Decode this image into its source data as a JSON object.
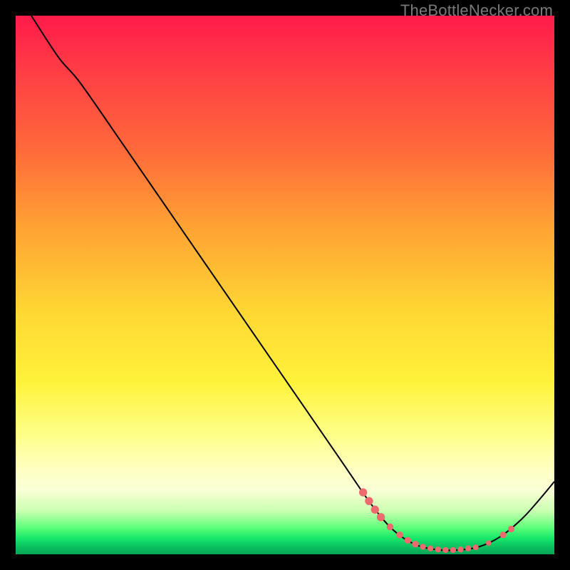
{
  "watermark": "TheBottleNecker.com",
  "chart_data": {
    "type": "line",
    "title": "",
    "xlabel": "",
    "ylabel": "",
    "xlim": [
      0,
      100
    ],
    "ylim": [
      0,
      100
    ],
    "grid": false,
    "curve": [
      {
        "x": 2.9,
        "y": 100.0
      },
      {
        "x": 8.0,
        "y": 92.2
      },
      {
        "x": 12.0,
        "y": 87.5
      },
      {
        "x": 20.0,
        "y": 76.0
      },
      {
        "x": 30.0,
        "y": 61.5
      },
      {
        "x": 40.0,
        "y": 47.0
      },
      {
        "x": 50.0,
        "y": 32.5
      },
      {
        "x": 60.0,
        "y": 18.0
      },
      {
        "x": 66.0,
        "y": 9.3
      },
      {
        "x": 70.0,
        "y": 4.6
      },
      {
        "x": 74.0,
        "y": 1.9
      },
      {
        "x": 78.0,
        "y": 0.9
      },
      {
        "x": 82.0,
        "y": 0.8
      },
      {
        "x": 86.0,
        "y": 1.4
      },
      {
        "x": 90.0,
        "y": 3.3
      },
      {
        "x": 94.0,
        "y": 6.6
      },
      {
        "x": 97.0,
        "y": 9.9
      },
      {
        "x": 100.0,
        "y": 13.5
      }
    ],
    "markers": [
      {
        "x": 64.5,
        "y": 11.5,
        "r": 5.7
      },
      {
        "x": 65.6,
        "y": 9.9,
        "r": 5.7
      },
      {
        "x": 66.7,
        "y": 8.3,
        "r": 5.7
      },
      {
        "x": 67.8,
        "y": 6.9,
        "r": 5.7
      },
      {
        "x": 69.5,
        "y": 5.1,
        "r": 4.8
      },
      {
        "x": 71.3,
        "y": 3.6,
        "r": 4.8
      },
      {
        "x": 72.8,
        "y": 2.6,
        "r": 4.7
      },
      {
        "x": 74.2,
        "y": 1.9,
        "r": 4.7
      },
      {
        "x": 75.6,
        "y": 1.4,
        "r": 4.2
      },
      {
        "x": 77.0,
        "y": 1.1,
        "r": 4.2
      },
      {
        "x": 78.4,
        "y": 0.9,
        "r": 4.2
      },
      {
        "x": 79.8,
        "y": 0.8,
        "r": 4.2
      },
      {
        "x": 81.2,
        "y": 0.8,
        "r": 4.2
      },
      {
        "x": 82.6,
        "y": 0.9,
        "r": 4.2
      },
      {
        "x": 84.0,
        "y": 1.1,
        "r": 4.2
      },
      {
        "x": 85.4,
        "y": 1.3,
        "r": 4.0
      },
      {
        "x": 87.8,
        "y": 2.1,
        "r": 3.8
      },
      {
        "x": 90.5,
        "y": 3.6,
        "r": 4.6
      },
      {
        "x": 92.0,
        "y": 4.7,
        "r": 4.6
      }
    ],
    "colors": {
      "curve": "#000000",
      "markers": "#ef6a6e"
    }
  }
}
